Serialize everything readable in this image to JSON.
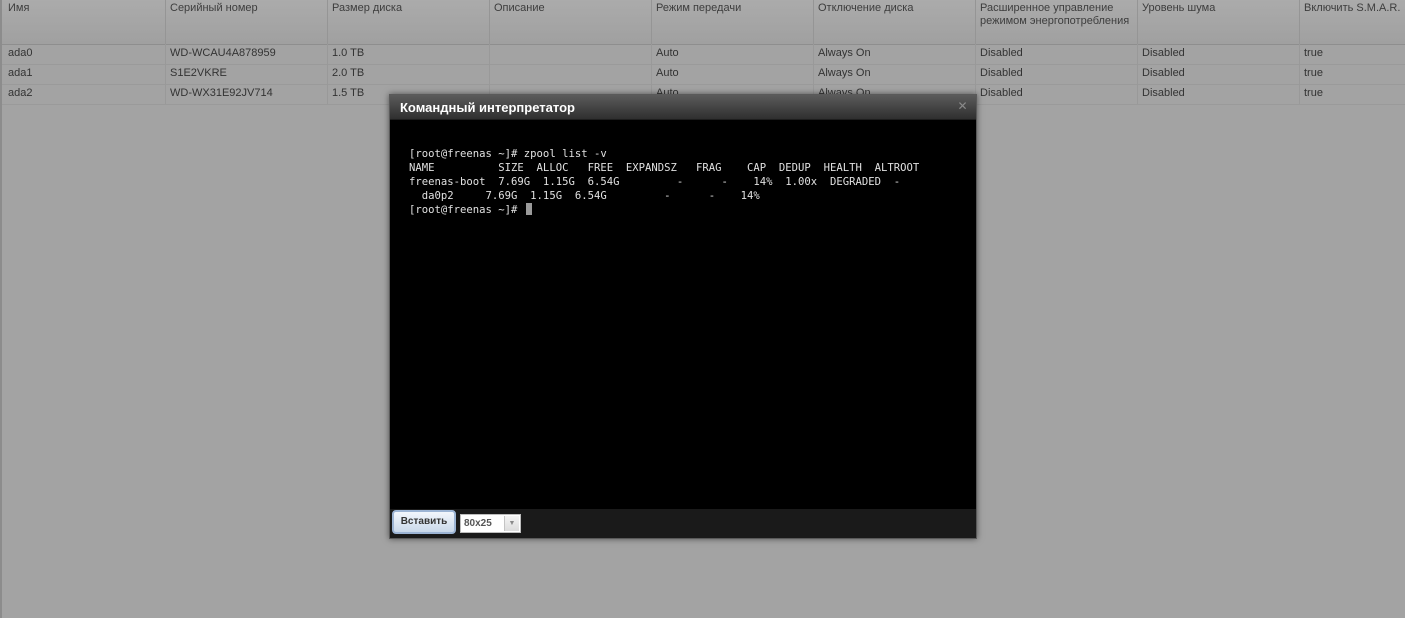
{
  "grid": {
    "columns": [
      "Имя",
      "Серийный номер",
      "Размер диска",
      "Описание",
      "Режим передачи",
      "Отключение диска",
      "Расширенное управление режимом энергопотребления",
      "Уровень шума",
      "Включить S.M.A.R."
    ],
    "rows": [
      [
        "ada0",
        "WD-WCAU4A878959",
        "1.0 TB",
        "",
        "Auto",
        "Always On",
        "Disabled",
        "Disabled",
        "true"
      ],
      [
        "ada1",
        "S1E2VKRE",
        "2.0 TB",
        "",
        "Auto",
        "Always On",
        "Disabled",
        "Disabled",
        "true"
      ],
      [
        "ada2",
        "WD-WX31E92JV714",
        "1.5 TB",
        "",
        "Auto",
        "Always On",
        "Disabled",
        "Disabled",
        "true"
      ]
    ]
  },
  "dialog": {
    "title": "Командный интерпретатор",
    "close_icon": "close-icon",
    "terminal": {
      "lines": [
        "[root@freenas ~]# zpool list -v",
        "NAME          SIZE  ALLOC   FREE  EXPANDSZ   FRAG    CAP  DEDUP  HEALTH  ALTROOT",
        "freenas-boot  7.69G  1.15G  6.54G         -      -    14%  1.00x  DEGRADED  -",
        "  da0p2     7.69G  1.15G  6.54G         -      -    14%",
        "[root@freenas ~]# "
      ]
    },
    "paste_label": "Вставить",
    "size_select_value": "80x25"
  }
}
